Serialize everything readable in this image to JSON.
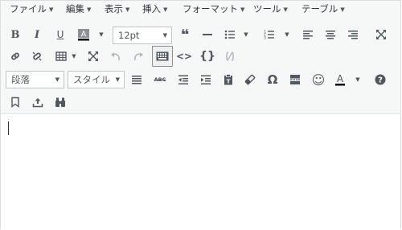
{
  "menubar": {
    "items": [
      {
        "label": "ファイル"
      },
      {
        "label": "編集"
      },
      {
        "label": "表示"
      },
      {
        "label": "挿入"
      },
      {
        "label": "フォーマット"
      },
      {
        "label": "ツール"
      },
      {
        "label": "テーブル"
      }
    ],
    "caret": "▼"
  },
  "toolbar": {
    "font_size_value": "12pt",
    "format_select_value": "段落",
    "style_select_value": "スタイル",
    "bold_label": "B",
    "italic_label": "I",
    "underline_label": "U",
    "text_color_label": "A",
    "quote_label": "❝",
    "code_label": "<>",
    "source_label": "{}",
    "strike_label": "ABC",
    "omega_label": "Ω",
    "emoji_label": "☺",
    "help_label": "?"
  },
  "colors": {
    "accent": "#50575e",
    "text_color_underline": "#000000",
    "active_border": "#8c8f94"
  }
}
